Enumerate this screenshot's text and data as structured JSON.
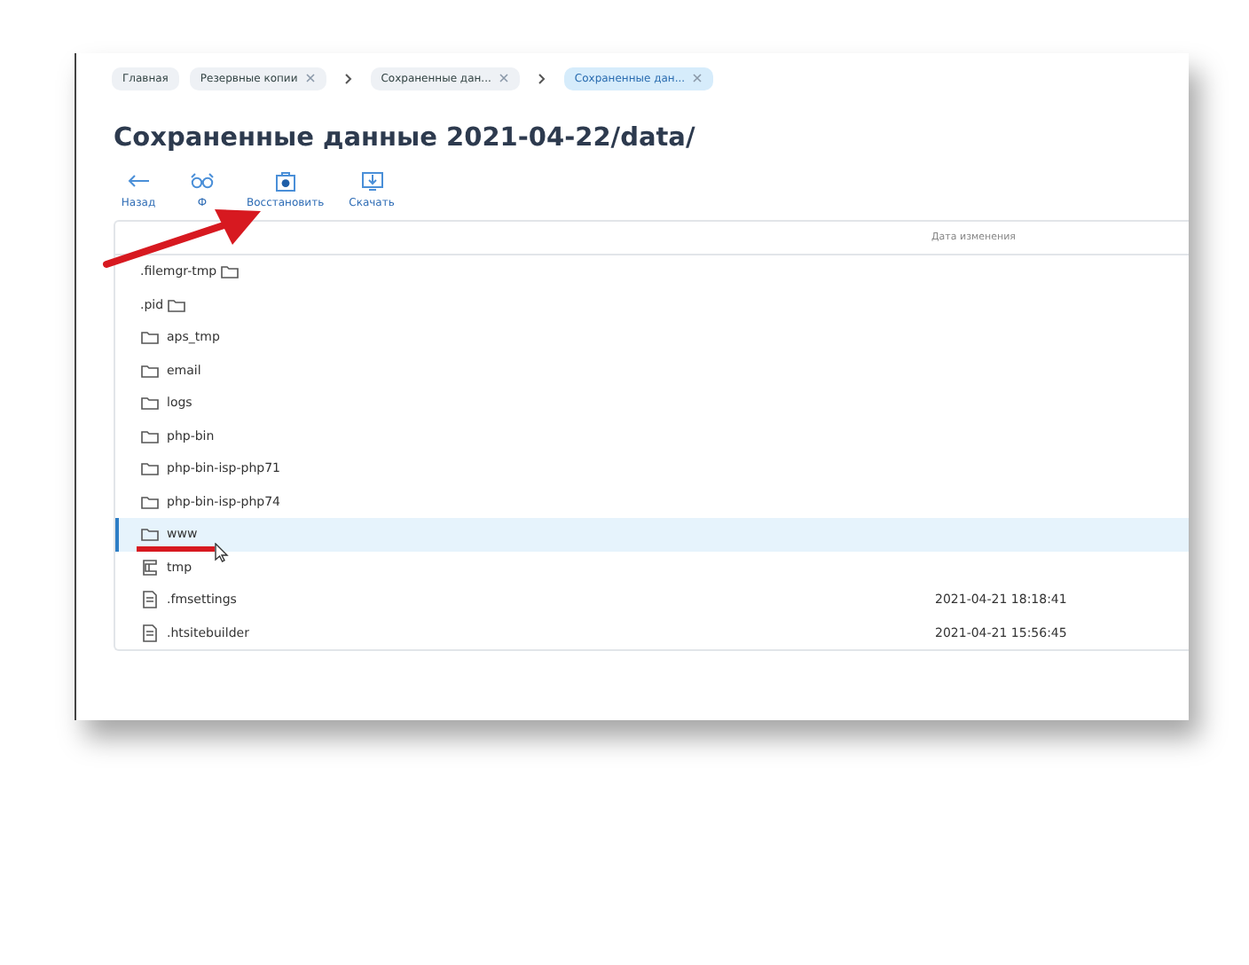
{
  "breadcrumbs": [
    {
      "label": "Главная",
      "closable": false,
      "selected": false
    },
    {
      "label": "Резервные копии",
      "closable": true,
      "selected": false
    },
    {
      "label": "Сохраненные дан...",
      "closable": true,
      "selected": false
    },
    {
      "label": "Сохраненные дан...",
      "closable": true,
      "selected": true
    }
  ],
  "title": "Сохраненные данные 2021-04-22/data/",
  "toolbar": [
    {
      "kind": "back",
      "label": "Назад"
    },
    {
      "kind": "view",
      "label": "Ф"
    },
    {
      "kind": "restore",
      "label": "Восстановить"
    },
    {
      "kind": "download",
      "label": "Скачать"
    }
  ],
  "table": {
    "columns": [
      "Дата изменения"
    ],
    "rows": [
      {
        "name": ".filemgr-tmp",
        "kind": "dotfolder",
        "date": "",
        "selected": false
      },
      {
        "name": ".pid",
        "kind": "dotfolder",
        "date": "",
        "selected": false
      },
      {
        "name": "aps_tmp",
        "kind": "folder",
        "date": "",
        "selected": false
      },
      {
        "name": "email",
        "kind": "folder",
        "date": "",
        "selected": false
      },
      {
        "name": "logs",
        "kind": "folder",
        "date": "",
        "selected": false
      },
      {
        "name": "php-bin",
        "kind": "folder",
        "date": "",
        "selected": false
      },
      {
        "name": "php-bin-isp-php71",
        "kind": "folder",
        "date": "",
        "selected": false
      },
      {
        "name": "php-bin-isp-php74",
        "kind": "folder",
        "date": "",
        "selected": false
      },
      {
        "name": "www",
        "kind": "folder",
        "date": "",
        "selected": true
      },
      {
        "name": "tmp",
        "kind": "link",
        "date": "",
        "selected": false
      },
      {
        "name": ".fmsettings",
        "kind": "file",
        "date": "2021-04-21 18:18:41",
        "selected": false
      },
      {
        "name": ".htsitebuilder",
        "kind": "file",
        "date": "2021-04-21 15:56:45",
        "selected": false
      }
    ]
  }
}
